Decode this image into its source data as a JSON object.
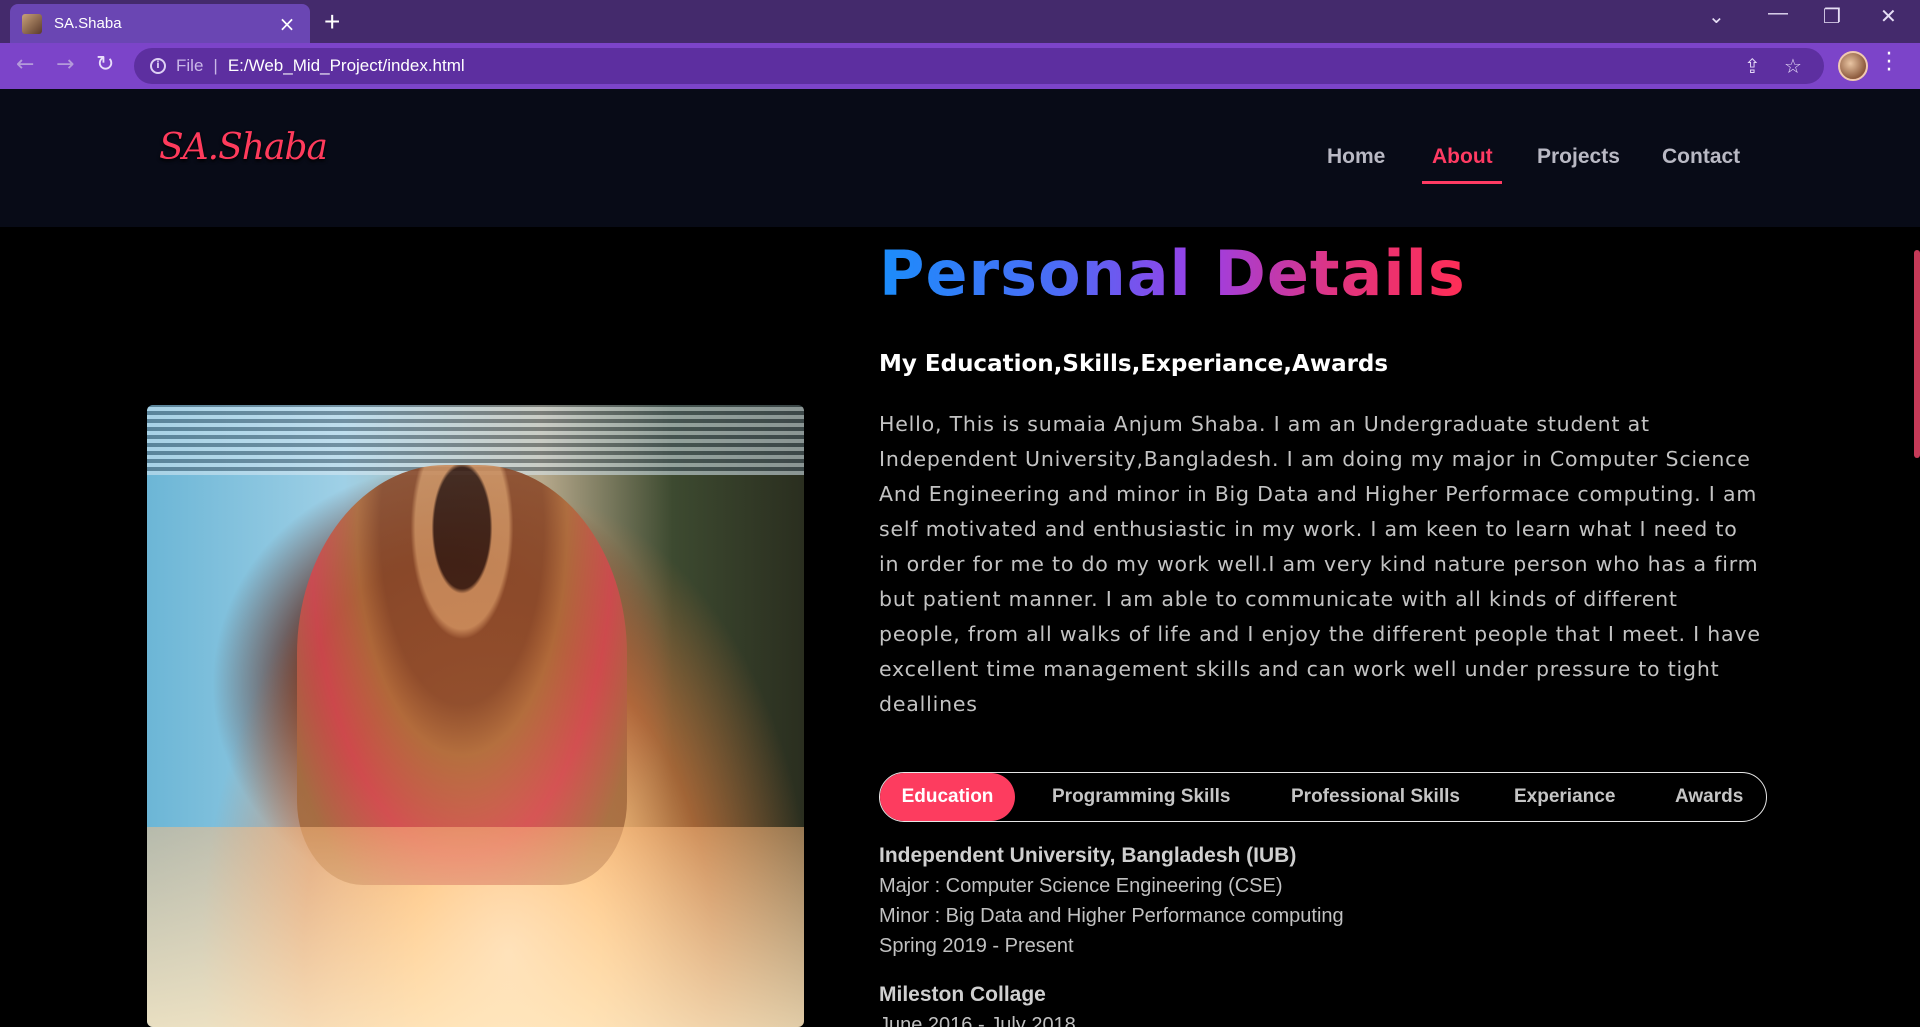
{
  "browser": {
    "tab_title": "SA.Shaba",
    "new_tab_symbol": "+",
    "file_label": "File",
    "url": "E:/Web_Mid_Project/index.html"
  },
  "site": {
    "logo": "SA.Shaba",
    "nav": [
      "Home",
      "About",
      "Projects",
      "Contact"
    ],
    "active_nav": "About"
  },
  "about": {
    "title": "Personal Details",
    "subtitle": "My Education,Skills,Experiance,Awards",
    "bio_lines": [
      "Hello, This is sumaia Anjum Shaba. I am an Undergraduate student at",
      "Independent University,Bangladesh. I am doing my major in Computer Science",
      "And Engineering and minor in Big Data and Higher Performace computing. I am",
      "self motivated and enthusiastic in my work. I am keen to learn what I need to",
      "in order for me to do my work well.I am very kind nature person who has a firm",
      "but patient manner. I am able to communicate with all kinds of different",
      "people, from all walks of life and I enjoy the different people that I meet. I have",
      "excellent time management skills and can work well under pressure to tight",
      "deallines"
    ],
    "tabs": [
      "Education",
      "Programming Skills",
      "Professional Skills",
      "Experiance",
      "Awards"
    ],
    "active_tab": "Education",
    "education": [
      {
        "institution": "Independent University, Bangladesh (IUB)",
        "lines": [
          "Major : Computer Science Engineering (CSE)",
          "Minor : Big Data and Higher Performance computing",
          "Spring 2019 - Present"
        ]
      },
      {
        "institution": "Mileston Collage",
        "lines": [
          "June 2016 - July 2018"
        ]
      }
    ]
  },
  "colors": {
    "accent": "#ff3b5c",
    "browser_frame": "#442a6c",
    "toolbar": "#7c44c9",
    "header_bg": "#080b17",
    "title_gradient": [
      "#1b8dfb",
      "#9b3fe6",
      "#ff2d55"
    ]
  },
  "icons": {
    "back": "arrow-left-icon",
    "forward": "arrow-right-icon",
    "reload": "reload-icon",
    "info": "info-icon",
    "share": "share-icon",
    "star": "star-icon",
    "menu": "kebab-menu-icon"
  }
}
